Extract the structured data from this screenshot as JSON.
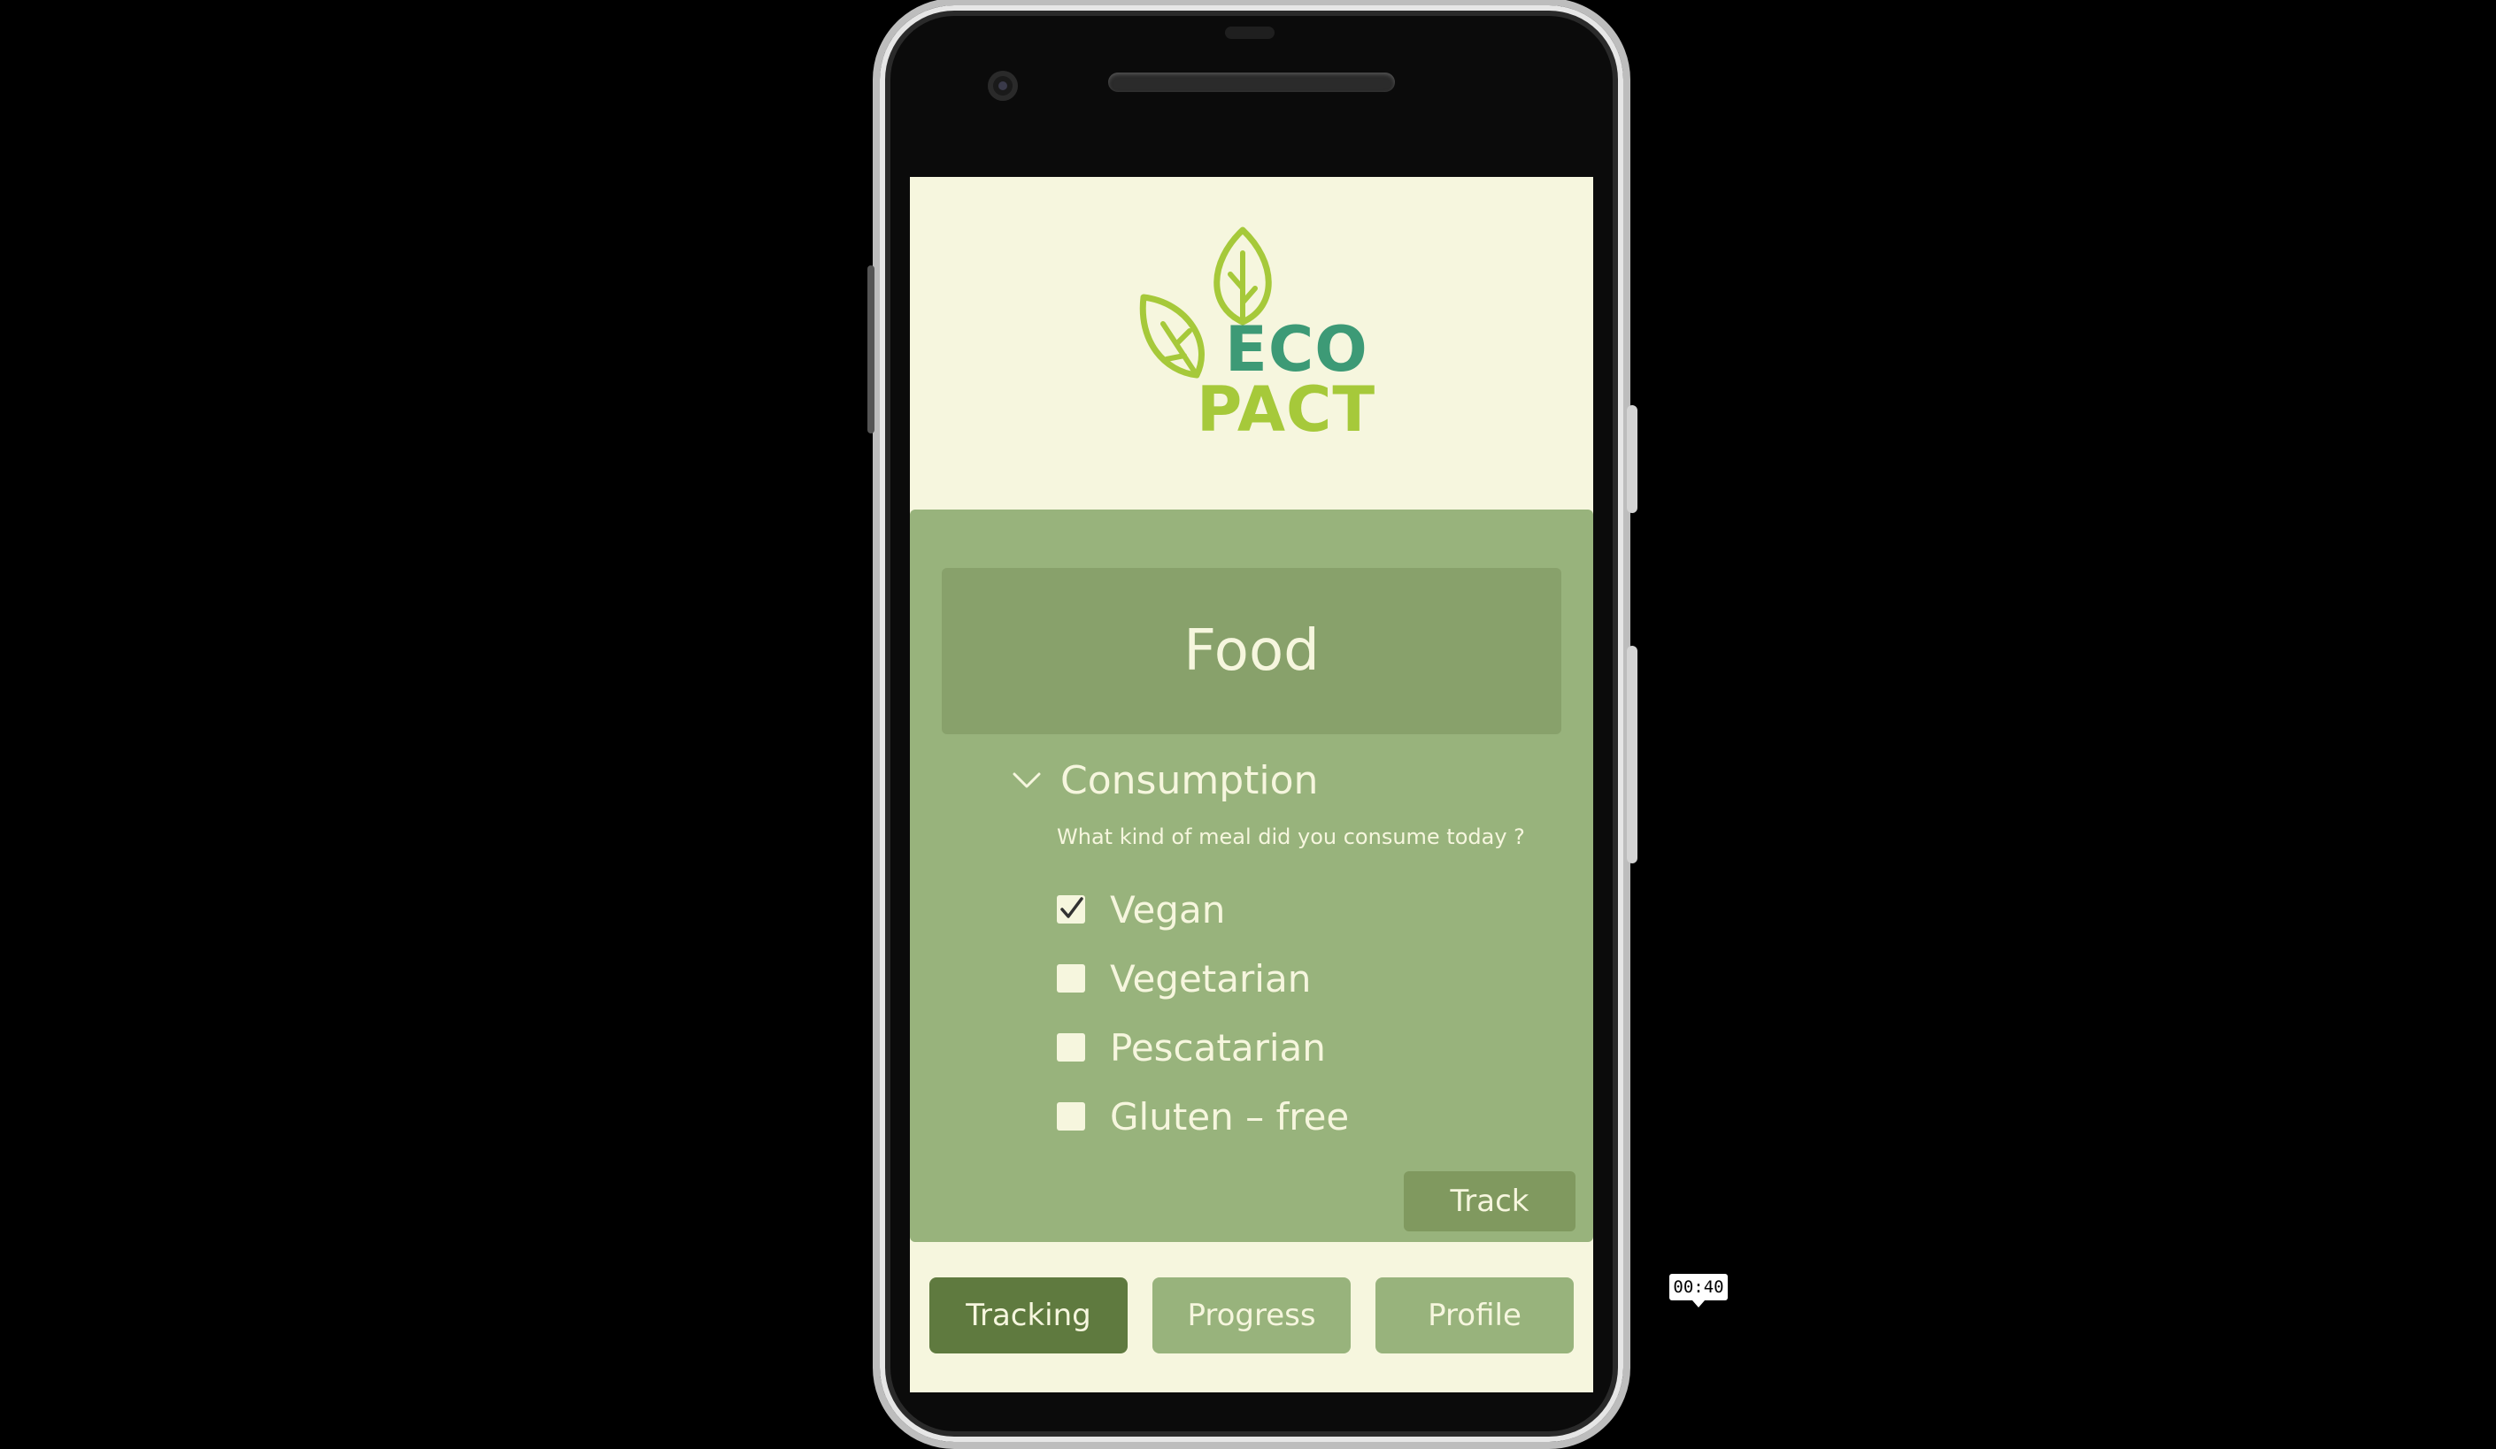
{
  "app": {
    "logo": {
      "line1": "ECO",
      "line2": "PACT",
      "icon": "leaves-icon"
    }
  },
  "category": {
    "title": "Food"
  },
  "section": {
    "label": "Consumption",
    "expanded": true,
    "question": "What kind of meal did you consume today ?",
    "options": [
      {
        "label": "Vegan",
        "checked": true
      },
      {
        "label": "Vegetarian",
        "checked": false
      },
      {
        "label": "Pescatarian",
        "checked": false
      },
      {
        "label": "Gluten – free",
        "checked": false
      }
    ],
    "submit_label": "Track"
  },
  "nav": {
    "active": "Tracking",
    "items": [
      {
        "label": "Tracking"
      },
      {
        "label": "Progress"
      },
      {
        "label": "Profile"
      }
    ]
  },
  "video": {
    "timestamp": "00:40"
  },
  "colors": {
    "screen_bg": "#f6f6de",
    "card_bg": "#98b37c",
    "title_bg": "#88a16b",
    "track_bg": "#80995f",
    "nav_active": "#5f7a3f",
    "logo_eco": "#3d9a76",
    "logo_pact": "#a6c93a"
  }
}
